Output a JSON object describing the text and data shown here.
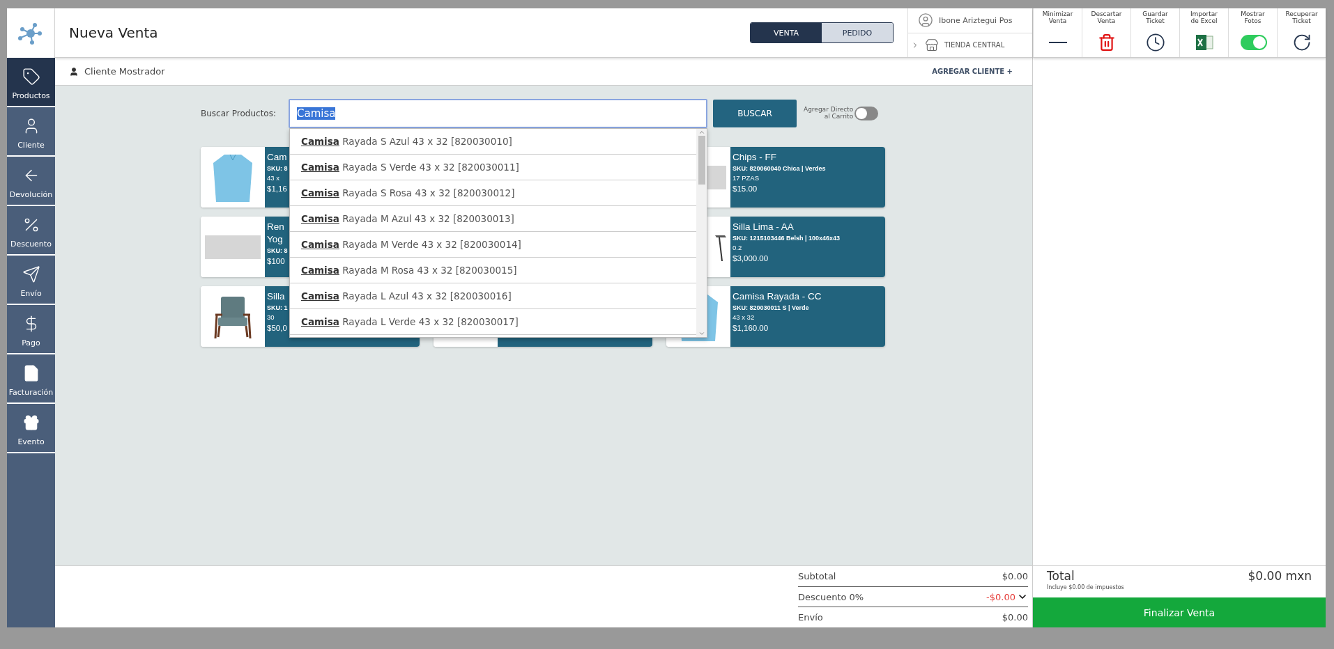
{
  "header": {
    "title": "Nueva Venta",
    "mode_tabs": [
      {
        "label": "VENTA",
        "selected": true
      },
      {
        "label": "PEDIDO",
        "selected": false
      }
    ],
    "user": {
      "name": "Ibone Ariztegui Pos"
    },
    "store": {
      "name": "TIENDA CENTRAL"
    }
  },
  "toolbar": [
    {
      "label": "Minimizar\nVenta",
      "kind": "minimize"
    },
    {
      "label": "Descartar\nVenta",
      "kind": "discard"
    },
    {
      "label": "Guardar\nTicket",
      "kind": "save"
    },
    {
      "label": "Importar\nde Excel",
      "kind": "excel"
    },
    {
      "label": "Mostrar\nFotos",
      "kind": "toggle",
      "on": true
    },
    {
      "label": "Recuperar\nTicket",
      "kind": "recover"
    }
  ],
  "sidebar": {
    "items": [
      {
        "label": "Productos",
        "selected": true
      },
      {
        "label": "Cliente",
        "selected": false
      },
      {
        "label": "Devolución",
        "selected": false
      },
      {
        "label": "Descuento",
        "selected": false
      },
      {
        "label": "Envío",
        "selected": false
      },
      {
        "label": "Pago",
        "selected": false
      },
      {
        "label": "Facturación",
        "selected": false
      },
      {
        "label": "Evento",
        "selected": false
      }
    ]
  },
  "client_bar": {
    "client": "Cliente Mostrador",
    "add_link": "AGREGAR CLIENTE +"
  },
  "search": {
    "label": "Buscar Productos:",
    "value": "Camisa",
    "text_selected": true,
    "button": "BUSCAR",
    "direct_add": {
      "label": "Agregar Directo\nal Carrito",
      "on": false
    },
    "suggestions": [
      "**Camisa** Rayada S Azul 43 x 32 [820030010]",
      "**Camisa** Rayada S Verde 43 x 32 [820030011]",
      "**Camisa** Rayada S Rosa 43 x 32 [820030012]",
      "**Camisa** Rayada M Azul 43 x 32 [820030013]",
      "**Camisa** Rayada M Verde 43 x 32 [820030014]",
      "**Camisa** Rayada M Rosa 43 x 32 [820030015]",
      "**Camisa** Rayada L Azul 43 x 32 [820030016]",
      "**Camisa** Rayada L Verde 43 x 32 [820030017]"
    ]
  },
  "products": [
    {
      "lines": [
        {
          "kind": "title",
          "text": "Cam"
        },
        {
          "kind": "sku",
          "text": "SKU: 8"
        },
        {
          "kind": "detail",
          "text": "43 x"
        },
        {
          "kind": "price",
          "text": "$1,16"
        }
      ]
    },
    {
      "lines": [
        {
          "kind": "title",
          "text": "Chips - FF"
        },
        {
          "kind": "sku",
          "text": "SKU: 820060040 Chica | Verdes"
        },
        {
          "kind": "detail",
          "text": "17 PZAS"
        },
        {
          "kind": "price",
          "text": "$15.00"
        }
      ]
    },
    {
      "lines": [
        {
          "kind": "title",
          "text": "Ren"
        },
        {
          "kind": "title",
          "text": "Yog"
        },
        {
          "kind": "sku",
          "text": "SKU: 8"
        },
        {
          "kind": "price",
          "text": "$100"
        }
      ]
    },
    {
      "lines": [
        {
          "kind": "title",
          "text": "Silla Lima - AA"
        },
        {
          "kind": "sku",
          "text": "SKU: 1215103446 Belsh | 100x46x43"
        },
        {
          "kind": "detail",
          "text": "0.2"
        },
        {
          "kind": "price",
          "text": "$3,000.00"
        }
      ]
    },
    {
      "lines": [
        {
          "kind": "title",
          "text": "Silla"
        },
        {
          "kind": "sku",
          "text": "SKU: 1"
        },
        {
          "kind": "detail",
          "text": "30"
        },
        {
          "kind": "price",
          "text": "$50,0"
        }
      ]
    },
    {
      "lines": [
        {
          "kind": "title",
          "text": "Camisa Rayada - CC"
        },
        {
          "kind": "sku",
          "text": "SKU: 820030011 S | Verde"
        },
        {
          "kind": "detail",
          "text": "43 x 32"
        },
        {
          "kind": "price",
          "text": "$1,160.00"
        }
      ]
    }
  ],
  "totals": {
    "rows": [
      {
        "label": "Subtotal",
        "value": "$0.00",
        "kind": "plain"
      },
      {
        "label": "Descuento 0%",
        "value": "-$0.00",
        "kind": "discount"
      },
      {
        "label": "Envío",
        "value": "$0.00",
        "kind": "plain"
      }
    ],
    "total_label": "Total",
    "total_value": "$0.00 mxn",
    "tax_note": "Incluye $0.00 de impuestos",
    "finish_button": "Finalizar Venta"
  }
}
